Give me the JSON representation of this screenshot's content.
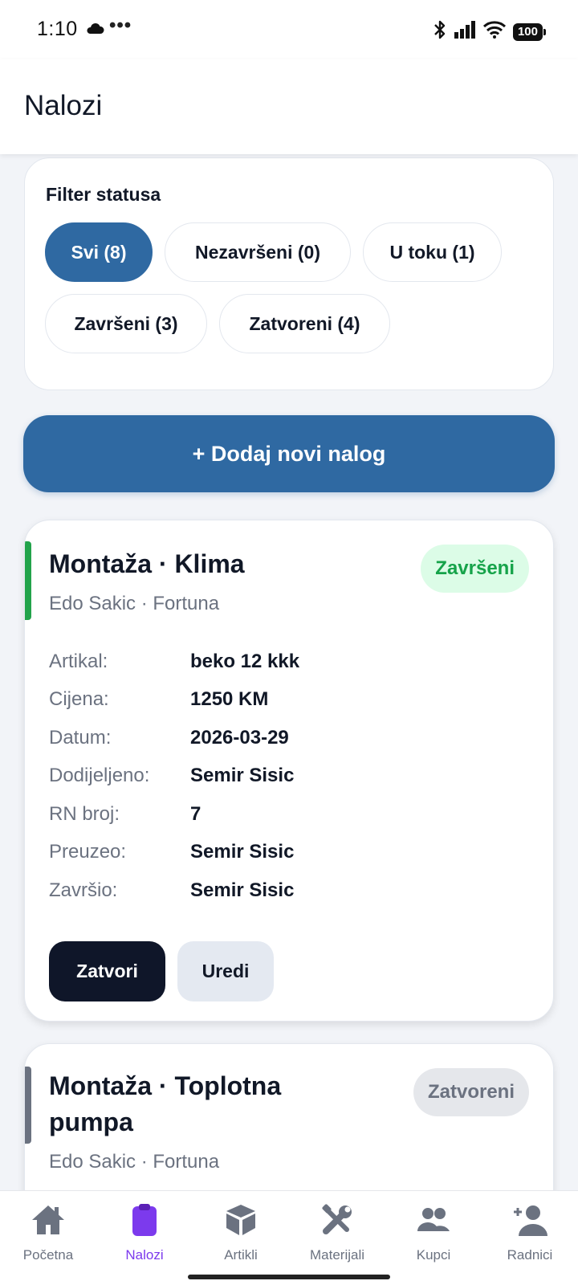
{
  "status_bar": {
    "time": "1:10",
    "dots": "•••",
    "battery": "100"
  },
  "header": {
    "title": "Nalozi"
  },
  "filter": {
    "title": "Filter statusa",
    "chips": [
      {
        "label": "Svi (8)",
        "active": true
      },
      {
        "label": "Nezavršeni (0)",
        "active": false
      },
      {
        "label": "U toku (1)",
        "active": false
      },
      {
        "label": "Završeni (3)",
        "active": false
      },
      {
        "label": "Zatvoreni (4)",
        "active": false
      }
    ]
  },
  "add_button": {
    "label": "+ Dodaj novi nalog"
  },
  "orders": [
    {
      "title": "Montaža · Klima",
      "subtitle": "Edo Sakic · Fortuna",
      "status": "Završeni",
      "status_color": "#16a34a",
      "status_bg": "#dcfce7",
      "accent_color": "#22a34a",
      "details": [
        {
          "label": "Artikal:",
          "value": "beko 12 kkk"
        },
        {
          "label": "Cijena:",
          "value": "1250 KM"
        },
        {
          "label": "Datum:",
          "value": "2026-03-29"
        },
        {
          "label": "Dodijeljeno:",
          "value": "Semir Sisic"
        },
        {
          "label": "RN broj:",
          "value": "7"
        },
        {
          "label": "Preuzeo:",
          "value": "Semir Sisic"
        },
        {
          "label": "Završio:",
          "value": "Semir Sisic"
        }
      ],
      "actions": {
        "close": "Zatvori",
        "edit": "Uredi"
      }
    },
    {
      "title_line1": "Montaža · Toplotna",
      "title_line2": "pumpa",
      "subtitle": "Edo Sakic · Fortuna",
      "status": "Zatvoreni",
      "status_color": "#6b7280",
      "status_bg": "#e5e7eb",
      "accent_color": "#6b7280"
    }
  ],
  "bottom_nav": [
    {
      "label": "Početna",
      "icon": "home-icon",
      "active": false
    },
    {
      "label": "Nalozi",
      "icon": "clipboard-icon",
      "active": true
    },
    {
      "label": "Artikli",
      "icon": "box-icon",
      "active": false
    },
    {
      "label": "Materijali",
      "icon": "tools-icon",
      "active": false
    },
    {
      "label": "Kupci",
      "icon": "users-icon",
      "active": false
    },
    {
      "label": "Radnici",
      "icon": "add-user-icon",
      "active": false
    }
  ],
  "colors": {
    "primary": "#2f69a2",
    "nav_active": "#7c3aed",
    "dark_button": "#0f1629"
  }
}
